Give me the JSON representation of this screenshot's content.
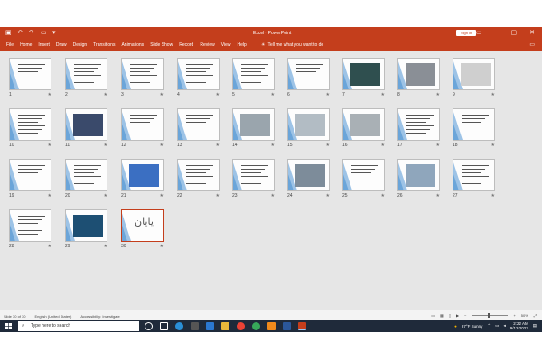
{
  "titlebar": {
    "doc_name": "Excel",
    "app_name": "PowerPoint",
    "sign_in": "Sign in",
    "accent": "#c43e1c"
  },
  "ribbon": {
    "tabs": [
      "File",
      "Home",
      "Insert",
      "Draw",
      "Design",
      "Transitions",
      "Animations",
      "Slide Show",
      "Record",
      "Review",
      "View",
      "Help"
    ],
    "tell_me": "Tell me what you want to do"
  },
  "slides": [
    "1",
    "2",
    "3",
    "4",
    "5",
    "6",
    "7",
    "8",
    "9",
    "10",
    "11",
    "12",
    "13",
    "14",
    "15",
    "16",
    "17",
    "18",
    "19",
    "20",
    "21",
    "22",
    "23",
    "24",
    "25",
    "26",
    "27",
    "28",
    "29",
    "30"
  ],
  "last_slide_text": "پایان",
  "status": {
    "slide_info": "Slide 30 of 30",
    "language": "English (United States)",
    "accessibility": "Accessibility: Investigate",
    "zoom": "50%"
  },
  "taskbar": {
    "search_placeholder": "Type here to search",
    "weather": "87°F  Sunny",
    "time": "2:22 AM",
    "date": "9/12/2023"
  }
}
